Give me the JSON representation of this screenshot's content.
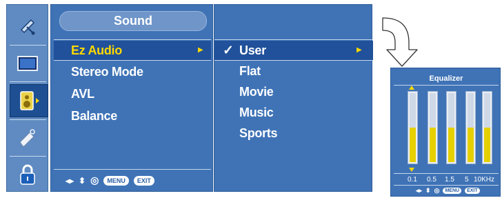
{
  "menu": {
    "title": "Sound",
    "items": [
      {
        "label": "Ez Audio",
        "selected": true
      },
      {
        "label": "Stereo Mode"
      },
      {
        "label": "AVL"
      },
      {
        "label": "Balance"
      }
    ],
    "submenu_arrow": "▶"
  },
  "submenu": {
    "check": "✓",
    "items": [
      {
        "label": "User",
        "selected": true
      },
      {
        "label": "Flat"
      },
      {
        "label": "Movie"
      },
      {
        "label": "Music"
      },
      {
        "label": "Sports"
      }
    ],
    "arrow": "▶"
  },
  "footer": {
    "nav_left_right": "◂▸",
    "nav_up_down": "⬍",
    "ok_icon": "◎",
    "menu_label": "MENU",
    "exit_label": "EXIT"
  },
  "sidebar": {
    "items": [
      "picture-icon",
      "screen-icon",
      "sound-icon",
      "option-icon",
      "lock-icon"
    ],
    "active_index": 2
  },
  "equalizer": {
    "title": "Equalizer",
    "bands": [
      {
        "freq": "0.1",
        "level": 0.5
      },
      {
        "freq": "0.5",
        "level": 0.5
      },
      {
        "freq": "1.5",
        "level": 0.5
      },
      {
        "freq": "5",
        "level": 0.5
      },
      {
        "freq": "10KHz",
        "level": 0.5
      }
    ],
    "menu_label": "MENU",
    "exit_label": "EXIT"
  },
  "colors": {
    "panel": "#3f73b6",
    "selection": "#20519a",
    "highlight_text": "#ffd800",
    "eq_fill": "#e6d000"
  }
}
